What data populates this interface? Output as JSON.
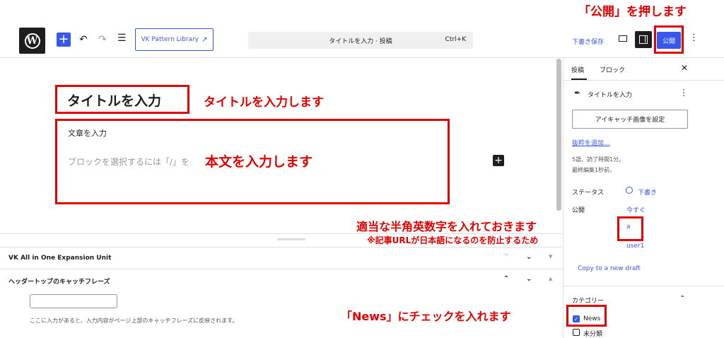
{
  "annotations": {
    "publish": "「公開」を押します",
    "title": "タイトルを入力します",
    "body": "本文を入力します",
    "slug_line1": "適当な半角英数字を入れておきます",
    "slug_line2": "※記事URLが日本語になるのを防止するため",
    "news": "「News」にチェックを入れます"
  },
  "toolbar": {
    "vk_pattern_label": "VK Pattern Library",
    "command_title": "タイトルを入力 · 投稿",
    "command_shortcut": "Ctrl+K",
    "save_draft": "下書き保存",
    "publish": "公開"
  },
  "editor": {
    "title": "タイトルを入力",
    "paragraph_heading": "文章を入力",
    "paragraph_placeholder": "ブロックを選択するには「/」を"
  },
  "meta_boxes": {
    "vk_title": "VK All in One Expansion Unit",
    "catch_title": "ヘッダートップのキャッチフレーズ",
    "catch_help": "ここに入力があると、入力内容がページ上部のキャッチフレーズに反映されます。"
  },
  "sidebar": {
    "tab_post": "投稿",
    "tab_block": "ブロック",
    "post_title": "タイトルを入力",
    "featured_image": "アイキャッチ画像を設定",
    "add_excerpt": "抜粋を追加…",
    "stats_line1": "5語、読了時間1分。",
    "stats_line2": "最終編集1秒前。",
    "status_label": "ステータス",
    "status_value": "下書き",
    "publish_label": "公開",
    "publish_value": "今すぐ",
    "slug_value": "a",
    "author_value": "user1",
    "copy_draft": "Copy to a new draft",
    "category_title": "カテゴリー",
    "category_news": "News",
    "category_uncat": "未分類"
  }
}
